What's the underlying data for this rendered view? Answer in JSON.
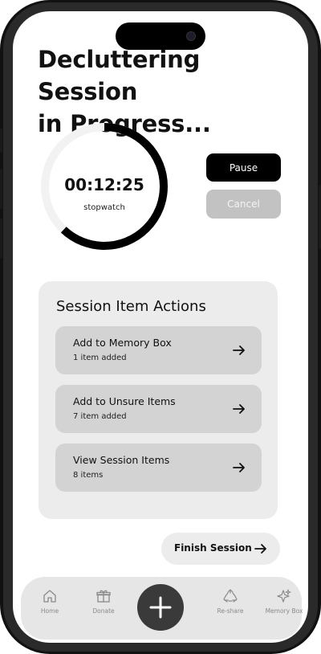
{
  "header": {
    "title_line1": "Decluttering Session",
    "title_line2": "in Progress..."
  },
  "timer": {
    "value": "00:12:25",
    "label": "stopwatch",
    "progress": 0.62
  },
  "controls": {
    "pause_label": "Pause",
    "cancel_label": "Cancel"
  },
  "session_actions": {
    "title": "Session Item Actions",
    "items": [
      {
        "label": "Add to Memory Box",
        "detail": "1 item added",
        "icon": "arrow-right-icon"
      },
      {
        "label": "Add to Unsure Items",
        "detail": "7 item added",
        "icon": "arrow-right-icon"
      },
      {
        "label": "View Session Items",
        "detail": "8 items",
        "icon": "arrow-right-icon"
      }
    ]
  },
  "finish": {
    "label": "Finish Session",
    "icon": "arrow-right-icon"
  },
  "nav": {
    "items": [
      {
        "label": "Home",
        "icon": "home-icon"
      },
      {
        "label": "Donate",
        "icon": "gift-icon"
      },
      {
        "label": "Re-share",
        "icon": "recycle-icon"
      },
      {
        "label": "Memory Box",
        "icon": "sparkle-icon"
      }
    ],
    "fab_icon": "plus-icon"
  },
  "colors": {
    "primary": "#000000",
    "panel": "#ececec",
    "card": "#d3d3d3",
    "disabled": "#c2c2c2",
    "track": "#f2f2f2"
  }
}
